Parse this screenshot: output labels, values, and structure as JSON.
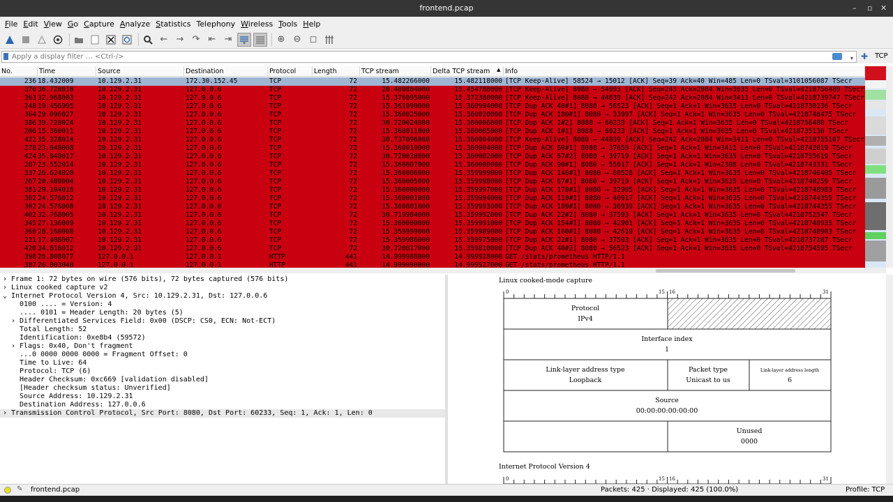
{
  "window": {
    "title": "frontend.pcap",
    "min": "–",
    "max": "▫",
    "close": "✕"
  },
  "menu": [
    {
      "u": "F",
      "rest": "ile"
    },
    {
      "u": "E",
      "rest": "dit"
    },
    {
      "u": "V",
      "rest": "iew"
    },
    {
      "u": "G",
      "rest": "o"
    },
    {
      "u": "C",
      "rest": "apture"
    },
    {
      "u": "A",
      "rest": "nalyze"
    },
    {
      "u": "S",
      "rest": "tatistics"
    },
    {
      "u": "",
      "rest": "Telephony"
    },
    {
      "u": "W",
      "rest": "ireless"
    },
    {
      "u": "T",
      "rest": "ools"
    },
    {
      "u": "H",
      "rest": "elp"
    }
  ],
  "filter": {
    "placeholder": "Apply a display filter … <Ctrl-/>",
    "profile_button": "TCP"
  },
  "columns": [
    "No.",
    "Time",
    "Source",
    "Destination",
    "Protocol",
    "Length",
    "TCP stream",
    "Delta TCP stream",
    "Info"
  ],
  "packets": [
    {
      "no": "236",
      "time": "18.432009",
      "src": "10.129.2.31",
      "dst": "172.30.152.45",
      "proto": "TCP",
      "len": "72",
      "stream": "15.482266000",
      "delta": "15.482118000",
      "info": "[TCP Keep-Alive] 58524 → 15012 [ACK] Seq=39 Ack=40 Win=485 Len=0 TSval=3101056087 TSecr"
    },
    {
      "no": "370",
      "time": "36.728018",
      "src": "10.129.2.31",
      "dst": "127.0.0.6",
      "proto": "TCP",
      "len": "72",
      "stream": "28.480804000",
      "delta": "15.454788000",
      "info": "[TCP Keep-Alive] 8080 → 54093 [ACK] Seq=243 Ack=2084 Win=3635 Len=0 TSval=4218756489 TSecr"
    },
    {
      "no": "363",
      "time": "32.968003",
      "src": "10.129.2.31",
      "dst": "127.0.0.6",
      "proto": "TCP",
      "len": "72",
      "stream": "15.376095000",
      "delta": "15.372380000",
      "info": "[TCP Keep-Alive] 8080 → 44839 [ACK] Seq=242 Ack=2084 Win=3411 Len=0 TSval=4218739747 TSecr"
    },
    {
      "no": "248",
      "time": "19.456995",
      "src": "10.129.2.31",
      "dst": "127.0.0.6",
      "proto": "TCP",
      "len": "72",
      "stream": "15.361090000",
      "delta": "15.360994000",
      "info": "[TCP Dup ACK 40#1] 8080 → 56523 [ACK] Seq=1 Ack=1 Win=3635 Len=0 TSval=4218730236 TSecr"
    },
    {
      "no": "364",
      "time": "29.096027",
      "src": "10.129.2.31",
      "dst": "127.0.0.6",
      "proto": "TCP",
      "len": "72",
      "stream": "15.360025000",
      "delta": "15.360020000",
      "info": "[TCP Dup ACK 180#1] 8080 → 33997 [ACK] Seq=1 Ack=1 Win=3635 Len=0 TSval=4218748475 TSecr"
    },
    {
      "no": "386",
      "time": "39.720024",
      "src": "10.129.2.31",
      "dst": "127.0.0.6",
      "proto": "TCP",
      "len": "72",
      "stream": "30.720024000",
      "delta": "15.360006000",
      "info": "[TCP Dup ACK 1#2] 8080 → 60233 [ACK] Seq=1 Ack=1 Win=3635 Len=0 TSval=4218756480 TSecr"
    },
    {
      "no": "206",
      "time": "15.360011",
      "src": "10.129.2.31",
      "dst": "127.0.0.6",
      "proto": "TCP",
      "len": "72",
      "stream": "15.360011000",
      "delta": "15.360005000",
      "info": "[TCP Dup ACK 1#1] 8080 → 60233 [ACK] Seq=1 Ack=1 Win=3635 Len=0 TSval=4218735130 TSecr"
    },
    {
      "no": "422",
      "time": "35.328014",
      "src": "10.129.2.31",
      "dst": "127.0.0.6",
      "proto": "TCP",
      "len": "72",
      "stream": "30.737096000",
      "delta": "15.360004000",
      "info": "[TCP Keep-Alive] 8080 → 44839 [ACK] Seq=242 Ack=2084 Win=3411 Len=0 TSval=4218755107 TSecr"
    },
    {
      "no": "278",
      "time": "23.048008",
      "src": "10.129.2.31",
      "dst": "127.0.0.6",
      "proto": "TCP",
      "len": "72",
      "stream": "15.360010000",
      "delta": "15.360004000",
      "info": "[TCP Dup ACK 60#1] 8080 → 37659 [ACK] Seq=1 Ack=1 Win=3411 Len=0 TSval=4218742819 TSecr"
    },
    {
      "no": "424",
      "time": "35.848017",
      "src": "10.129.2.31",
      "dst": "127.0.0.6",
      "proto": "TCP",
      "len": "72",
      "stream": "30.720028000",
      "delta": "15.360002000",
      "info": "[TCP Dup ACK 67#2] 8080 → 39719 [ACK] Seq=1 Ack=1 Win=3635 Len=0 TSval=4218755619 TSecr"
    },
    {
      "no": "287",
      "time": "23.552014",
      "src": "10.129.2.31",
      "dst": "127.0.0.6",
      "proto": "TCP",
      "len": "72",
      "stream": "15.360007000",
      "delta": "15.360000000",
      "info": "[TCP Dup ACK 90#1] 8080 → 55017 [ACK] Seq=1 Ack=1 Win=2308 Len=0 TSval=4218743331 TSecr"
    },
    {
      "no": "337",
      "time": "26.624020",
      "src": "10.129.2.31",
      "dst": "127.0.0.6",
      "proto": "TCP",
      "len": "72",
      "stream": "15.360006000",
      "delta": "15.359999000",
      "info": "[TCP Dup ACK 146#1] 8080 → 60528 [ACK] Seq=1 Ack=1 Win=3635 Len=0 TSval=4218746405 TSecr"
    },
    {
      "no": "267",
      "time": "20.480004",
      "src": "10.129.2.31",
      "dst": "127.0.0.6",
      "proto": "TCP",
      "len": "72",
      "stream": "15.360005000",
      "delta": "15.359998000",
      "info": "[TCP Dup ACK 67#1] 8080 → 39719 [ACK] Seq=1 Ack=1 Win=3635 Len=0 TSval=4218740259 TSecr"
    },
    {
      "no": "381",
      "time": "29.104016",
      "src": "10.129.2.31",
      "dst": "127.0.0.6",
      "proto": "TCP",
      "len": "72",
      "stream": "15.360000000",
      "delta": "15.359997000",
      "info": "[TCP Dup ACK 170#1] 8080 → 32905 [ACK] Seq=1 Ack=1 Win=3635 Len=0 TSval=4218748983 TSecr"
    },
    {
      "no": "302",
      "time": "24.576012",
      "src": "10.129.2.31",
      "dst": "127.0.0.6",
      "proto": "TCP",
      "len": "72",
      "stream": "15.360001000",
      "delta": "15.359994000",
      "info": "[TCP Dup ACK 110#1] 8080 → 40917 [ACK] Seq=1 Ack=1 Win=3635 Len=0 TSval=4218744355 TSecr"
    },
    {
      "no": "302",
      "time": "24.576008",
      "src": "10.129.2.31",
      "dst": "127.0.0.6",
      "proto": "TCP",
      "len": "72",
      "stream": "15.360001000",
      "delta": "15.359993000",
      "info": "[TCP Dup ACK 109#1] 8080 → 36939 [ACK] Seq=1 Ack=1 Win=3635 Len=0 TSval=4218744355 TSecr"
    },
    {
      "no": "402",
      "time": "32.768005",
      "src": "10.129.2.31",
      "dst": "127.0.0.6",
      "proto": "TCP",
      "len": "72",
      "stream": "30.719984000",
      "delta": "15.359992000",
      "info": "[TCP Dup ACK 22#2] 8080 → 37593 [ACK] Seq=1 Ack=1 Win=3635 Len=0 TSval=4218752547 TSecr"
    },
    {
      "no": "345",
      "time": "27.136009",
      "src": "10.129.2.31",
      "dst": "127.0.0.6",
      "proto": "TCP",
      "len": "72",
      "stream": "15.360000000",
      "delta": "15.359991000",
      "info": "[TCP Dup ACK 154#1] 8080 → 42901 [ACK] Seq=1 Ack=1 Win=3635 Len=0 TSval=4218748935 TSecr"
    },
    {
      "no": "360",
      "time": "28.160008",
      "src": "10.129.2.31",
      "dst": "127.0.0.6",
      "proto": "TCP",
      "len": "72",
      "stream": "15.359999000",
      "delta": "15.359989000",
      "info": "[TCP Dup ACK 160#1] 8080 → 42619 [ACK] Seq=1 Ack=1 Win=3635 Len=0 TSval=4218748903 TSecr"
    },
    {
      "no": "221",
      "time": "17.408007",
      "src": "10.129.2.31",
      "dst": "127.0.0.6",
      "proto": "TCP",
      "len": "72",
      "stream": "15.359986000",
      "delta": "15.359975000",
      "info": "[TCP Dup ACK 22#1] 8080 → 37593 [ACK] Seq=1 Ack=1 Win=3635 Len=0 TSval=4218737187 TSecr"
    },
    {
      "no": "420",
      "time": "34.816012",
      "src": "10.129.2.31",
      "dst": "127.0.0.6",
      "proto": "TCP",
      "len": "72",
      "stream": "30.720017000",
      "delta": "15.359810000",
      "info": "[TCP Dup ACK 40#2] 8080 → 56523 [ACK] Seq=1 Ack=1 Win=3635 Len=0 TSval=4218754595 TSecr"
    },
    {
      "no": "398",
      "time": "26.808077",
      "src": "127.0.0.1",
      "dst": "127.0.0.1",
      "proto": "HTTP",
      "len": "441",
      "stream": "14.999988000",
      "delta": "14.999928000",
      "info": "GET /stats/prometheus HTTP/1.1"
    },
    {
      "no": "387",
      "time": "26.803040",
      "src": "127.0.0.1",
      "dst": "127.0.0.1",
      "proto": "HTTP",
      "len": "441",
      "stream": "14.999990000",
      "delta": "14.999927000",
      "info": "GET /stats/prometheus HTTP/1.1"
    }
  ],
  "details": [
    {
      "arrow": "›",
      "text": "Frame 1: 72 bytes on wire (576 bits), 72 bytes captured (576 bits)"
    },
    {
      "arrow": "›",
      "text": "Linux cooked capture v2"
    },
    {
      "arrow": "⌄",
      "text": "Internet Protocol Version 4, Src: 10.129.2.31, Dst: 127.0.0.6"
    },
    {
      "arrow": "",
      "text": "0100 .... = Version: 4"
    },
    {
      "arrow": "",
      "text": ".... 0101 = Header Length: 20 bytes (5)"
    },
    {
      "arrow": "›",
      "text": "Differentiated Services Field: 0x00 (DSCP: CS0, ECN: Not-ECT)"
    },
    {
      "arrow": "",
      "text": "Total Length: 52"
    },
    {
      "arrow": "",
      "text": "Identification: 0xe8b4 (59572)"
    },
    {
      "arrow": "›",
      "text": "Flags: 0x40, Don't fragment"
    },
    {
      "arrow": "",
      "text": "...0 0000 0000 0000 = Fragment Offset: 0"
    },
    {
      "arrow": "",
      "text": "Time to Live: 64"
    },
    {
      "arrow": "",
      "text": "Protocol: TCP (6)"
    },
    {
      "arrow": "",
      "text": "Header Checksum: 0xc669 [validation disabled]"
    },
    {
      "arrow": "",
      "text": "[Header checksum status: Unverified]"
    },
    {
      "arrow": "",
      "text": "Source Address: 10.129.2.31"
    },
    {
      "arrow": "",
      "text": "Destination Address: 127.0.0.6"
    },
    {
      "arrow": "›",
      "text": "Transmission Control Protocol, Src Port: 8080, Dst Port: 60233, Seq: 1, Ack: 1, Len: 0"
    }
  ],
  "diagram": {
    "title": "Linux cooked-mode capture",
    "ticks": [
      "0",
      "15",
      "16",
      "31"
    ],
    "protocol_label": "Protocol",
    "protocol_value": "IPv4",
    "iface_label": "Interface index",
    "iface_value": "1",
    "lla_type_label": "Link-layer address type",
    "lla_type_value": "Loopback",
    "packet_type_label": "Packet type",
    "packet_type_value": "Unicast to us",
    "lla_len_label": "Link-layer address length",
    "lla_len_value": "6",
    "source_label": "Source",
    "source_value": "00:00:00:00:00:00",
    "unused_label": "Unused",
    "unused_value": "0000",
    "title2": "Internet Protocol Version 4"
  },
  "status": {
    "file": "frontend.pcap",
    "packets": "Packets: 425 · Displayed: 425 (100.0%)",
    "profile": "Profile: TCP"
  },
  "colors": {
    "bad_tcp_bg": "#c9000f",
    "selected_bg": "#9fb6d3",
    "titlebar": "#353535"
  }
}
